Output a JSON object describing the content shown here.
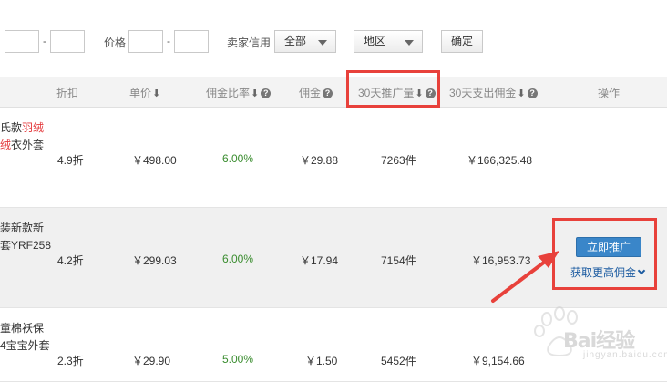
{
  "filters": {
    "price_label": "价格",
    "seller_credit_label": "卖家信用",
    "credit_select": "全部",
    "region_select": "地区",
    "confirm_button": "确定",
    "dash": "-",
    "cut_label": " "
  },
  "columns": {
    "discount": "折扣",
    "unit_price": "单价",
    "commission_rate": "佣金比率",
    "commission": "佣金",
    "promo_30d": "30天推广量",
    "spend_30d": "30天支出佣金",
    "action": "操作"
  },
  "rows": [
    {
      "title_l1a": "氏款",
      "title_l1b": "羽绒",
      "title_l2a": "绒",
      "title_l2b": "衣外套",
      "discount": "4.9折",
      "price": "￥498.00",
      "rate": "6.00%",
      "commission": "￥29.88",
      "promo": "7263件",
      "spend": "￥166,325.48"
    },
    {
      "title_l1": "装新款新",
      "title_l2": "套YRF258",
      "discount": "4.2折",
      "price": "￥299.03",
      "rate": "6.00%",
      "commission": "￥17.94",
      "promo": "7154件",
      "spend": "￥16,953.73"
    },
    {
      "title_l1": "童棉袄保",
      "title_l2": "4宝宝外套",
      "discount": "2.3折",
      "price": "￥29.90",
      "rate": "5.00%",
      "commission": "￥1.50",
      "promo": "5452件",
      "spend": "￥9,154.66"
    }
  ],
  "actions": {
    "promote_button": "立即推广",
    "more_commission_link": "获取更高佣金"
  },
  "watermark": {
    "text": "Bai经验",
    "url": "jingyan.baidu.com"
  },
  "colors": {
    "accent_red": "#e8413b",
    "button_blue": "#3a86c9",
    "link_blue": "#1a5aa0",
    "rate_green": "#3a8d2f",
    "title_red": "#e4393c"
  }
}
